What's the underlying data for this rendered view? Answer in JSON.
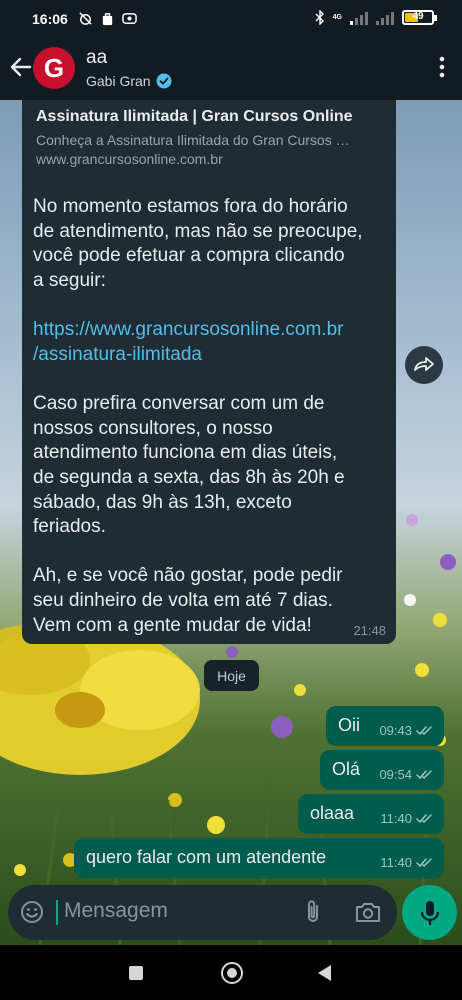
{
  "status_bar": {
    "time": "16:06",
    "network": "4G",
    "battery_level": "49",
    "battery_fraction": 0.49
  },
  "header": {
    "avatar_letter": "G",
    "chat_name": "aa",
    "subtitle": "Gabi Gran",
    "avatar_color": "#c8102e",
    "verified_color": "#53bdeb"
  },
  "incoming_message": {
    "link_preview": {
      "title": "Assinatura Ilimitada | Gran Cursos Online",
      "description": "Conheça a Assinatura Ilimitada do Gran Cursos …",
      "url": "www.grancursosonline.com.br"
    },
    "lines": [
      "No momento estamos fora do horário",
      "de atendimento, mas não se preocupe,",
      "você pode efetuar a compra clicando",
      "a seguir:",
      "",
      "https://www.grancursosonline.com.br",
      "/assinatura-ilimitada",
      "",
      "Caso prefira conversar com um de",
      "nossos consultores, o nosso",
      "atendimento funciona em dias úteis,",
      "de segunda a sexta, das 8h às 20h e",
      "sábado, das 9h às 13h, exceto",
      "feriados.",
      "",
      "Ah, e se você não gostar, pode pedir",
      "seu dinheiro de volta em até 7 dias.",
      "Vem com a gente mudar de vida!"
    ],
    "time": "21:48"
  },
  "date_separator": "Hoje",
  "outgoing_messages": [
    {
      "text": "Oii",
      "time": "09:43"
    },
    {
      "text": "Olá",
      "time": "09:54"
    },
    {
      "text": "olaaa",
      "time": "11:40"
    },
    {
      "text": "quero falar com um atendente",
      "time": "11:40"
    }
  ],
  "composer": {
    "placeholder": "Mensagem"
  },
  "colors": {
    "app_bar": "#111b21",
    "incoming_bubble": "#202c33",
    "outgoing_bubble": "#005c4b",
    "accent": "#00a884",
    "link": "#53bdeb"
  },
  "icons": [
    "back-arrow-icon",
    "verified-icon",
    "more-options-icon",
    "forward-icon",
    "emoji-icon",
    "attach-icon",
    "camera-icon",
    "mic-icon",
    "double-check-icon"
  ]
}
